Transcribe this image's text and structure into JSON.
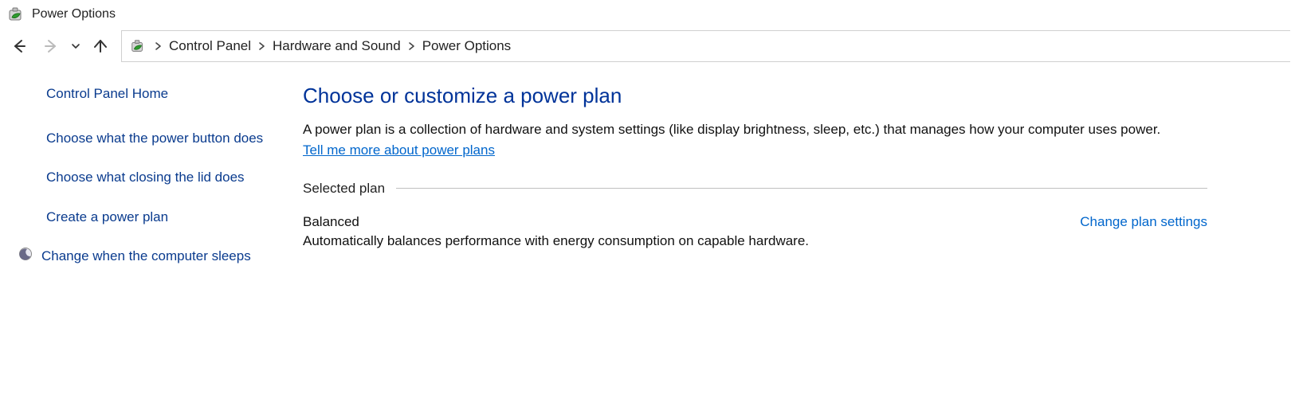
{
  "title": "Power Options",
  "breadcrumb": {
    "items": [
      "Control Panel",
      "Hardware and Sound",
      "Power Options"
    ]
  },
  "sidebar": {
    "home": "Control Panel Home",
    "items": [
      "Choose what the power button does",
      "Choose what closing the lid does",
      "Create a power plan",
      "Change when the computer sleeps"
    ]
  },
  "main": {
    "heading": "Choose or customize a power plan",
    "description": "A power plan is a collection of hardware and system settings (like display brightness, sleep, etc.) that manages how your computer uses power. ",
    "more_link": "Tell me more about power plans",
    "group_label": "Selected plan",
    "plan": {
      "name": "Balanced",
      "change_link": "Change plan settings",
      "description": "Automatically balances performance with energy consumption on capable hardware."
    }
  }
}
